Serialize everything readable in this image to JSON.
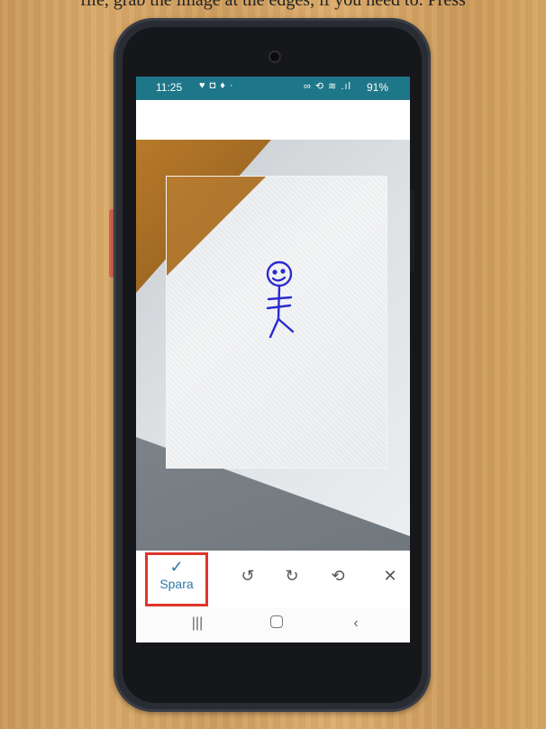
{
  "caption": {
    "text": "file, grab the image at the edges, if you need to. Press "
  },
  "status_bar": {
    "time": "11:25",
    "left_icons": "♥ ◘ ♦ ·",
    "right_icons": "∞ ⟲ ≋ .ıl",
    "battery": "91%"
  },
  "toolbar": {
    "save_check": "✓",
    "save_label": "Spara",
    "rotate_left_icon": "↺",
    "rotate_right_icon": "↻",
    "reset_icon": "⟲",
    "close_icon": "✕"
  },
  "navbar": {
    "recents_icon": "|||",
    "back_icon": "‹"
  },
  "colors": {
    "status_bar": "#1e7689",
    "save_highlight": "#e0342a",
    "save_text": "#2f78a6",
    "ink": "#2a2ad0"
  }
}
